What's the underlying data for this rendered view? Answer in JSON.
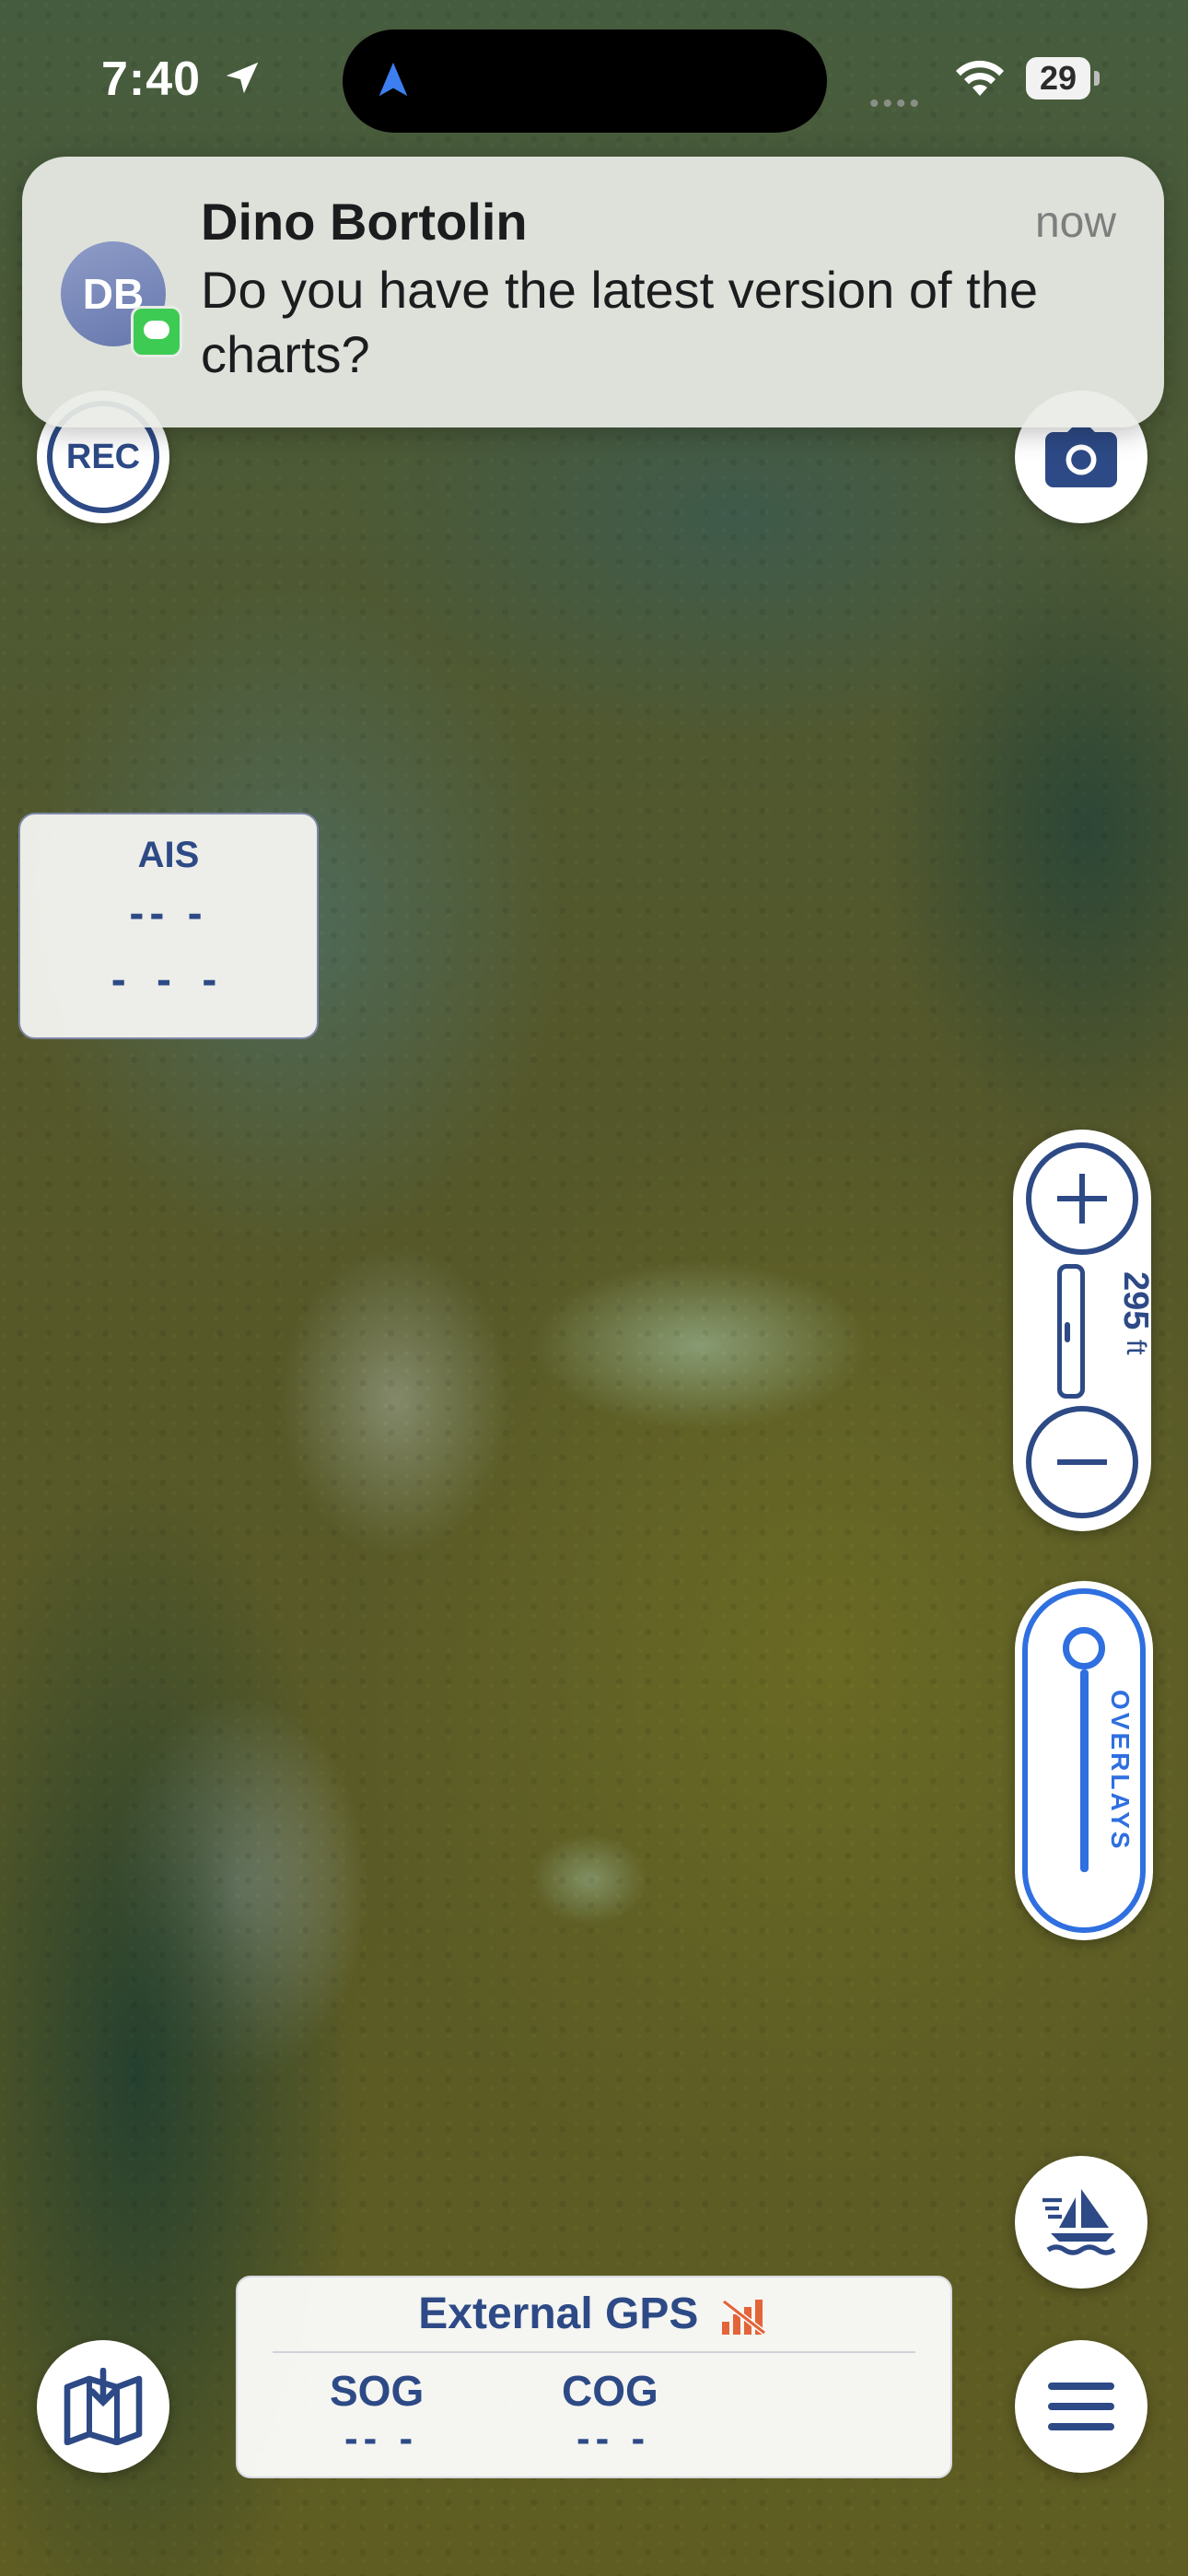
{
  "status_bar": {
    "time": "7:40",
    "battery": "29"
  },
  "notification": {
    "avatar_initials": "DB",
    "sender": "Dino Bortolin",
    "time": "now",
    "message": "Do you have the latest version of the charts?"
  },
  "buttons": {
    "rec_label": "REC"
  },
  "ais": {
    "title": "AIS",
    "value1": "-- -",
    "value2": "- - -"
  },
  "zoom": {
    "scale_value": "295",
    "scale_unit": "ft"
  },
  "overlays": {
    "label": "OVERLAYS"
  },
  "gps": {
    "title": "External GPS",
    "sog_label": "SOG",
    "sog_value": "-- -",
    "cog_label": "COG",
    "cog_value": "-- -"
  },
  "colors": {
    "accent_navy": "#2d4a86",
    "accent_blue": "#2f6fe0",
    "gps_signal_warning": "#e4643a"
  }
}
